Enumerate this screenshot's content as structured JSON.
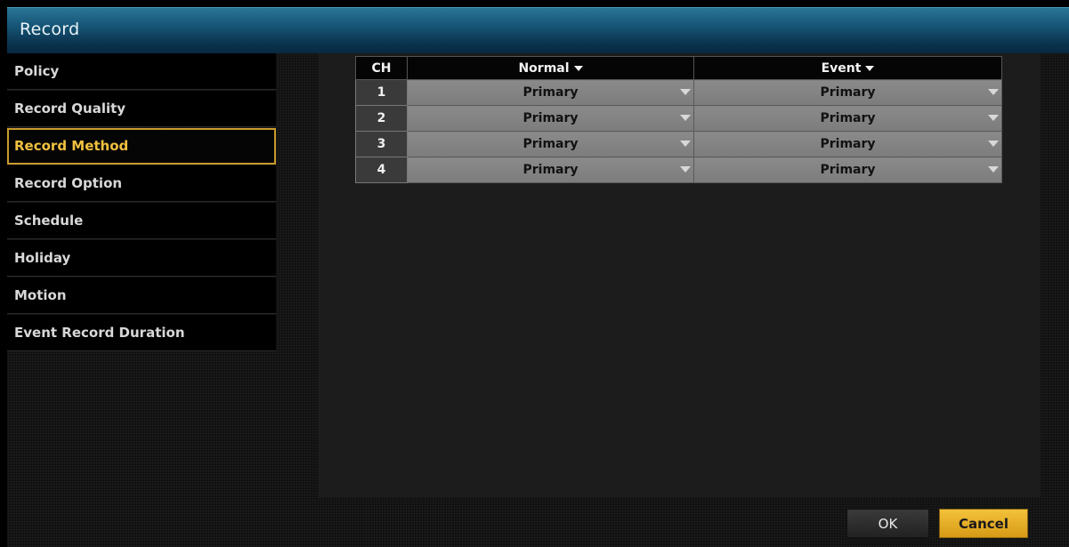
{
  "window": {
    "title": "Record"
  },
  "sidebar": {
    "items": [
      {
        "label": "Policy"
      },
      {
        "label": "Record Quality"
      },
      {
        "label": "Record Method"
      },
      {
        "label": "Record Option"
      },
      {
        "label": "Schedule"
      },
      {
        "label": "Holiday"
      },
      {
        "label": "Motion"
      },
      {
        "label": "Event Record Duration"
      }
    ],
    "active_index": 2
  },
  "table": {
    "headers": {
      "ch": "CH",
      "normal": "Normal",
      "event": "Event"
    },
    "rows": [
      {
        "ch": "1",
        "normal": "Primary",
        "event": "Primary"
      },
      {
        "ch": "2",
        "normal": "Primary",
        "event": "Primary"
      },
      {
        "ch": "3",
        "normal": "Primary",
        "event": "Primary"
      },
      {
        "ch": "4",
        "normal": "Primary",
        "event": "Primary"
      }
    ]
  },
  "footer": {
    "ok_label": "OK",
    "cancel_label": "Cancel"
  },
  "colors": {
    "accent": "#c99a2e",
    "cancel_button": "#e6ac22",
    "titlebar": "#17587a"
  },
  "icons": {
    "dropdown": "caret-down-icon"
  }
}
